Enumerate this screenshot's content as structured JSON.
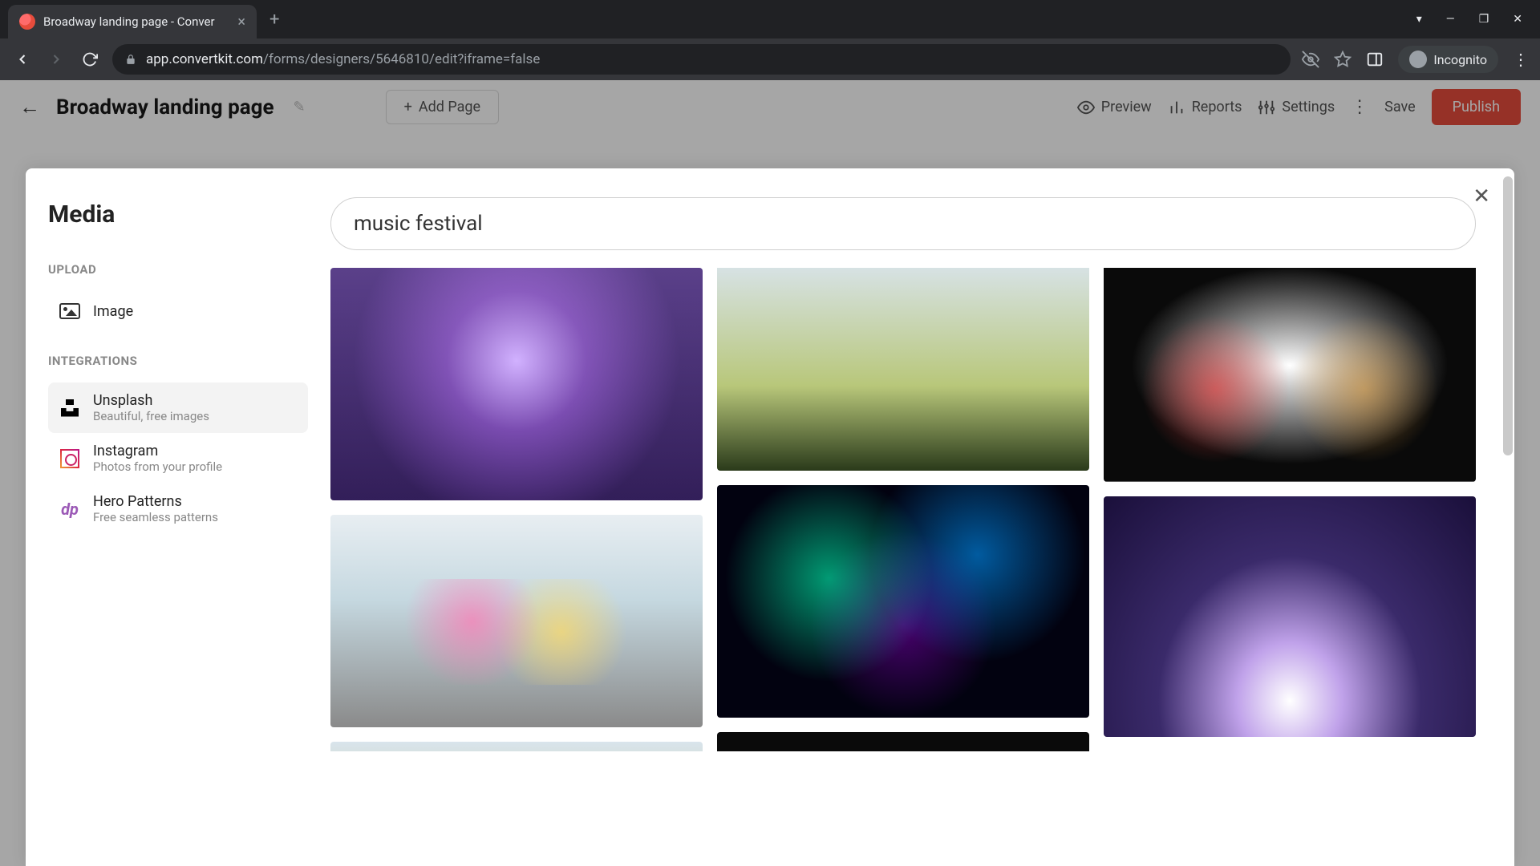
{
  "browser": {
    "tab_title": "Broadway landing page - Conver",
    "url_host": "app.convertkit.com",
    "url_path": "/forms/designers/5646810/edit?iframe=false",
    "incognito_label": "Incognito"
  },
  "header": {
    "page_title": "Broadway landing page",
    "add_page": "Add Page",
    "preview": "Preview",
    "reports": "Reports",
    "settings": "Settings",
    "save": "Save",
    "publish": "Publish"
  },
  "modal": {
    "title": "Media",
    "upload_label": "UPLOAD",
    "image_label": "Image",
    "integrations_label": "INTEGRATIONS",
    "search_value": "music festival",
    "integrations": [
      {
        "name": "Unsplash",
        "desc": "Beautiful, free images"
      },
      {
        "name": "Instagram",
        "desc": "Photos from your profile"
      },
      {
        "name": "Hero Patterns",
        "desc": "Free seamless patterns"
      }
    ]
  }
}
